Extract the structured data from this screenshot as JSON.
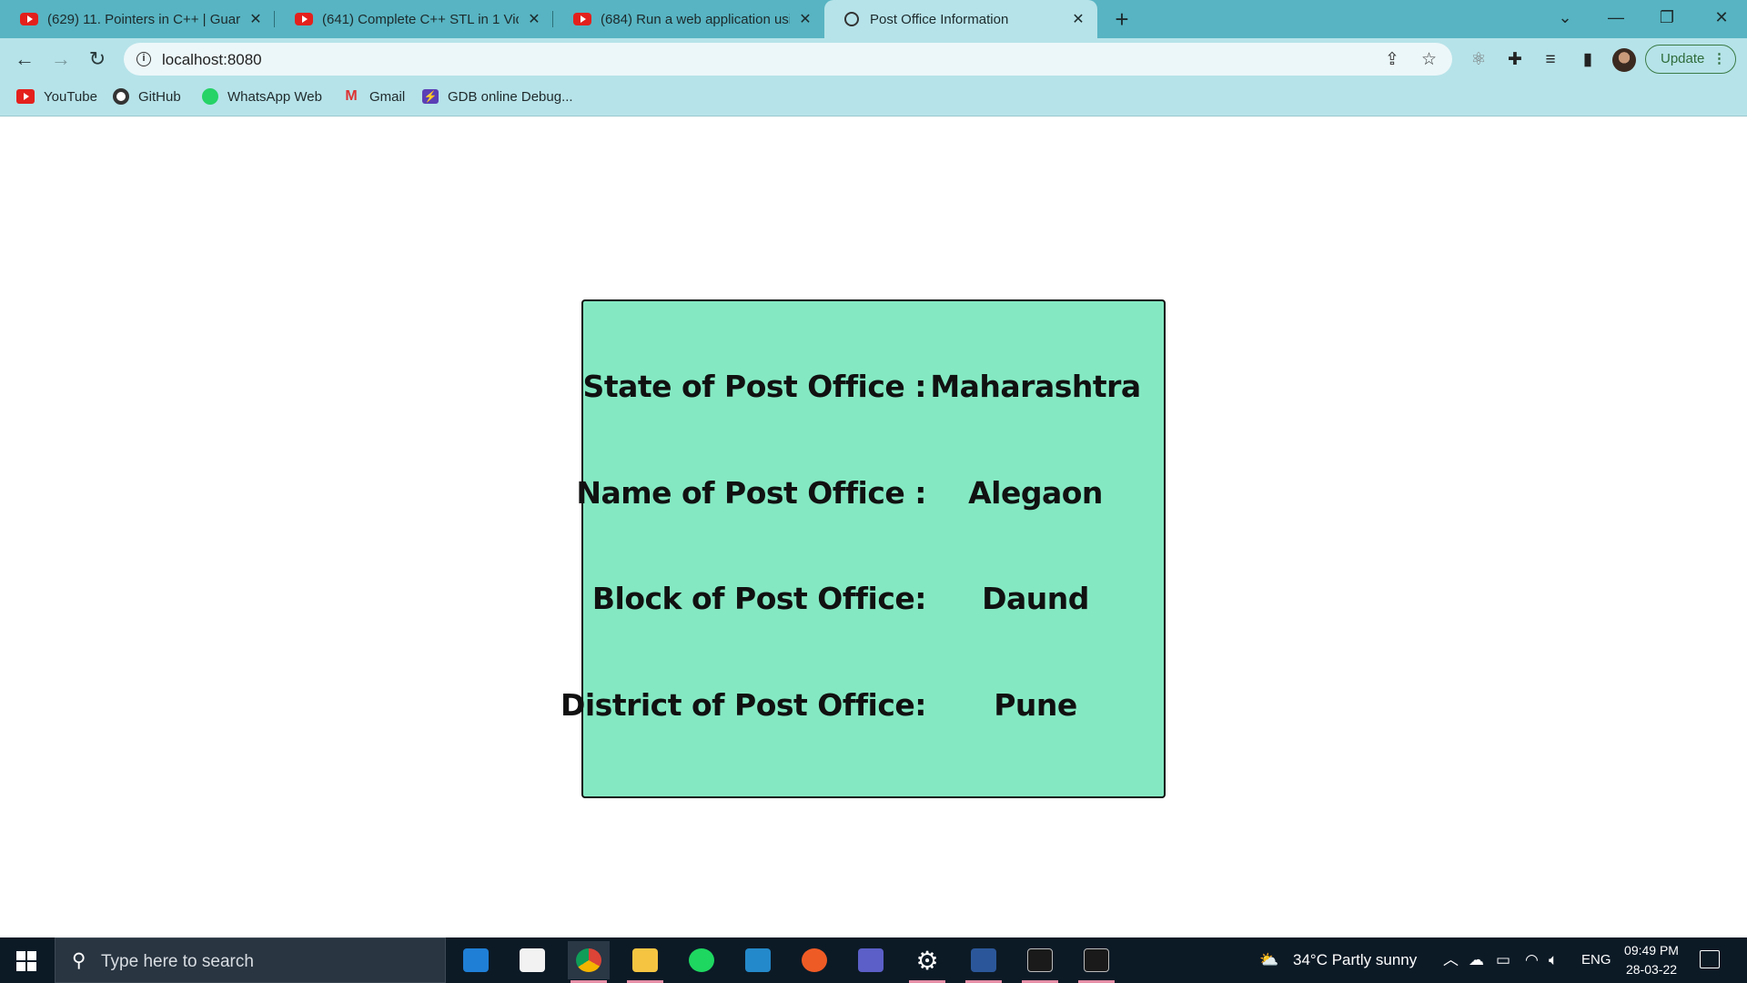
{
  "browser": {
    "tabs": [
      {
        "title": "(629) 11. Pointers in C++ | Guarav",
        "icon": "youtube-icon"
      },
      {
        "title": "(641) Complete C++ STL in 1 Video",
        "icon": "youtube-icon"
      },
      {
        "title": "(684) Run a web application using",
        "icon": "youtube-icon"
      },
      {
        "title": "Post Office Information",
        "icon": "globe-icon",
        "active": true
      }
    ],
    "close_glyph": "✕",
    "new_tab_glyph": "+",
    "url": "localhost:8080",
    "update_label": "Update",
    "bookmarks": [
      {
        "label": "YouTube",
        "icon": "youtube-icon"
      },
      {
        "label": "GitHub",
        "icon": "github-icon"
      },
      {
        "label": "WhatsApp Web",
        "icon": "whatsapp-icon"
      },
      {
        "label": "Gmail",
        "icon": "gmail-icon"
      },
      {
        "label": "GDB online Debug...",
        "icon": "gdb-icon"
      }
    ]
  },
  "post_office": {
    "rows": [
      {
        "label": "State of Post Office :",
        "value": "Maharashtra"
      },
      {
        "label": "Name of Post Office :",
        "value": "Alegaon"
      },
      {
        "label": "Block of Post Office:",
        "value": "Daund"
      },
      {
        "label": "District of Post Office:",
        "value": "Pune"
      }
    ],
    "card_color": "#84e9c3"
  },
  "taskbar": {
    "search_placeholder": "Type here to search",
    "weather": "34°C  Partly sunny",
    "language": "ENG",
    "time": "09:49 PM",
    "date": "28-03-22"
  },
  "colors": {
    "tabstrip": "#58b4c2",
    "toolbar": "#b6e3e9",
    "taskbar": "#0c1a26"
  }
}
